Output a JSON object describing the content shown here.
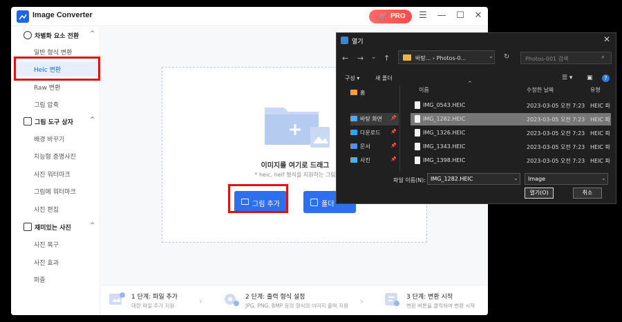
{
  "app": {
    "title": "Image Converter",
    "pro_label": "PRO",
    "window_controls": [
      "menu-icon",
      "minimize-icon",
      "maximize-icon",
      "close-icon"
    ],
    "accent_color": "#2d6fef",
    "pro_color": "#ff5555"
  },
  "sidebar": {
    "groups": [
      {
        "label": "차별화 요소 전환",
        "items": [
          "일반 형식 변환",
          "Heic 변환",
          "Raw 변환",
          "그림 압축"
        ]
      },
      {
        "label": "그림 도구 상자",
        "items": [
          "배경 바꾸기",
          "지능형 증명사진",
          "사진 워터마크",
          "그림에 워터마크",
          "사진 편집"
        ]
      },
      {
        "label": "재미있는 사진",
        "items": [
          "사진 복구",
          "사진 효과",
          "퍼즐"
        ]
      }
    ],
    "active_item": "Heic 변환"
  },
  "dropzone": {
    "title": "이미지를 여기로 드래그",
    "subtitle": "* heic, heif 형식을 지원하는 그림",
    "add_button": "그림 추가",
    "folder_button": "폴더"
  },
  "steps": [
    {
      "title": "1 단계: 파일 추가",
      "desc": "대량 파일 추가 지원"
    },
    {
      "title": "2 단계: 출력 형식 설정",
      "desc": "JPG, PNG, BMP 등의 형식의 이미지 출력 지원"
    },
    {
      "title": "3 단계: 변환 시작",
      "desc": "변환 버튼을 클릭하여 변환 시작"
    }
  ],
  "dialog": {
    "title": "열기",
    "address": "바탕... › Photos-0...",
    "search_placeholder": "Photos-001 검색",
    "organize_label": "구성 ▾",
    "new_folder_label": "새 폴더",
    "tree": [
      {
        "label": "홈",
        "icon": "home-icon"
      },
      {
        "label": "바탕 화면",
        "icon": "desktop-folder-icon",
        "selected": true
      },
      {
        "label": "다운로드",
        "icon": "downloads-folder-icon"
      },
      {
        "label": "문서",
        "icon": "documents-folder-icon"
      },
      {
        "label": "사진",
        "icon": "pictures-folder-icon"
      }
    ],
    "columns": {
      "name": "이름",
      "date": "수정한 날짜",
      "type": "유형"
    },
    "files": [
      {
        "name": "IMG_0543.HEIC",
        "date": "2023-03-05 오전 7:23",
        "type": "HEIC 파"
      },
      {
        "name": "IMG_1282.HEIC",
        "date": "2023-03-05 오전 7:23",
        "type": "HEIC 파",
        "selected": true
      },
      {
        "name": "IMG_1326.HEIC",
        "date": "2023-03-05 오전 7:23",
        "type": "HEIC 파"
      },
      {
        "name": "IMG_1343.HEIC",
        "date": "2023-03-05 오전 7:23",
        "type": "HEIC 파"
      },
      {
        "name": "IMG_1398.HEIC",
        "date": "2023-03-05 오전 7:23",
        "type": "HEIC 파"
      }
    ],
    "filename_label": "파일 이름(N):",
    "filename_value": "IMG_1282.HEIC",
    "filetype_value": "Image",
    "open_button": "열기(O)",
    "cancel_button": "취소"
  }
}
